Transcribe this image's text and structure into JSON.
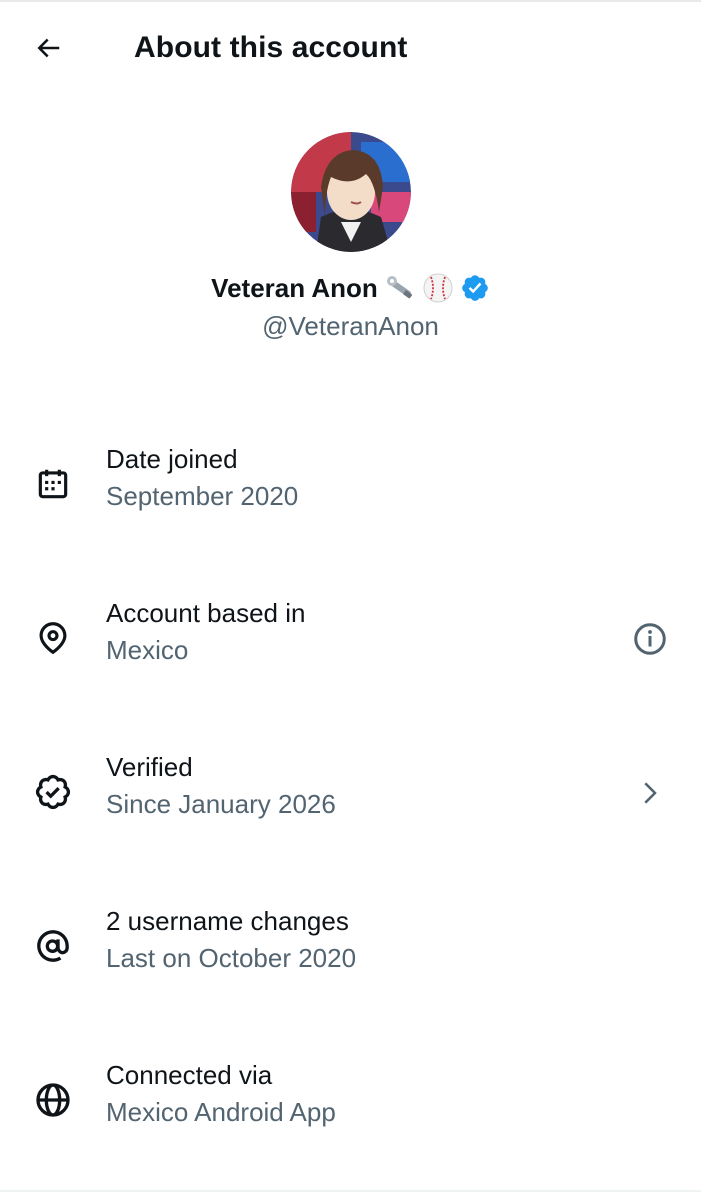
{
  "header": {
    "title": "About this account",
    "back_icon": "arrow-left-icon"
  },
  "profile": {
    "display_name": "Veteran Anon",
    "handle": "@VeteranAnon",
    "badges": [
      "wrench-icon",
      "baseball-icon",
      "verified-badge-icon"
    ],
    "verified_color": "#1d9bf0"
  },
  "rows": [
    {
      "icon": "calendar-icon",
      "label": "Date joined",
      "value": "September 2020",
      "trailing": ""
    },
    {
      "icon": "location-pin-icon",
      "label": "Account based in",
      "value": "Mexico",
      "trailing": "info-icon"
    },
    {
      "icon": "verified-outline-icon",
      "label": "Verified",
      "value": "Since January 2026",
      "trailing": "chevron-right-icon"
    },
    {
      "icon": "at-sign-icon",
      "label": "2 username changes",
      "value": "Last on October 2020",
      "trailing": ""
    },
    {
      "icon": "globe-icon",
      "label": "Connected via",
      "value": "Mexico Android App",
      "trailing": ""
    }
  ],
  "colors": {
    "text_primary": "#0f1419",
    "text_secondary": "#536471",
    "accent": "#1d9bf0"
  }
}
